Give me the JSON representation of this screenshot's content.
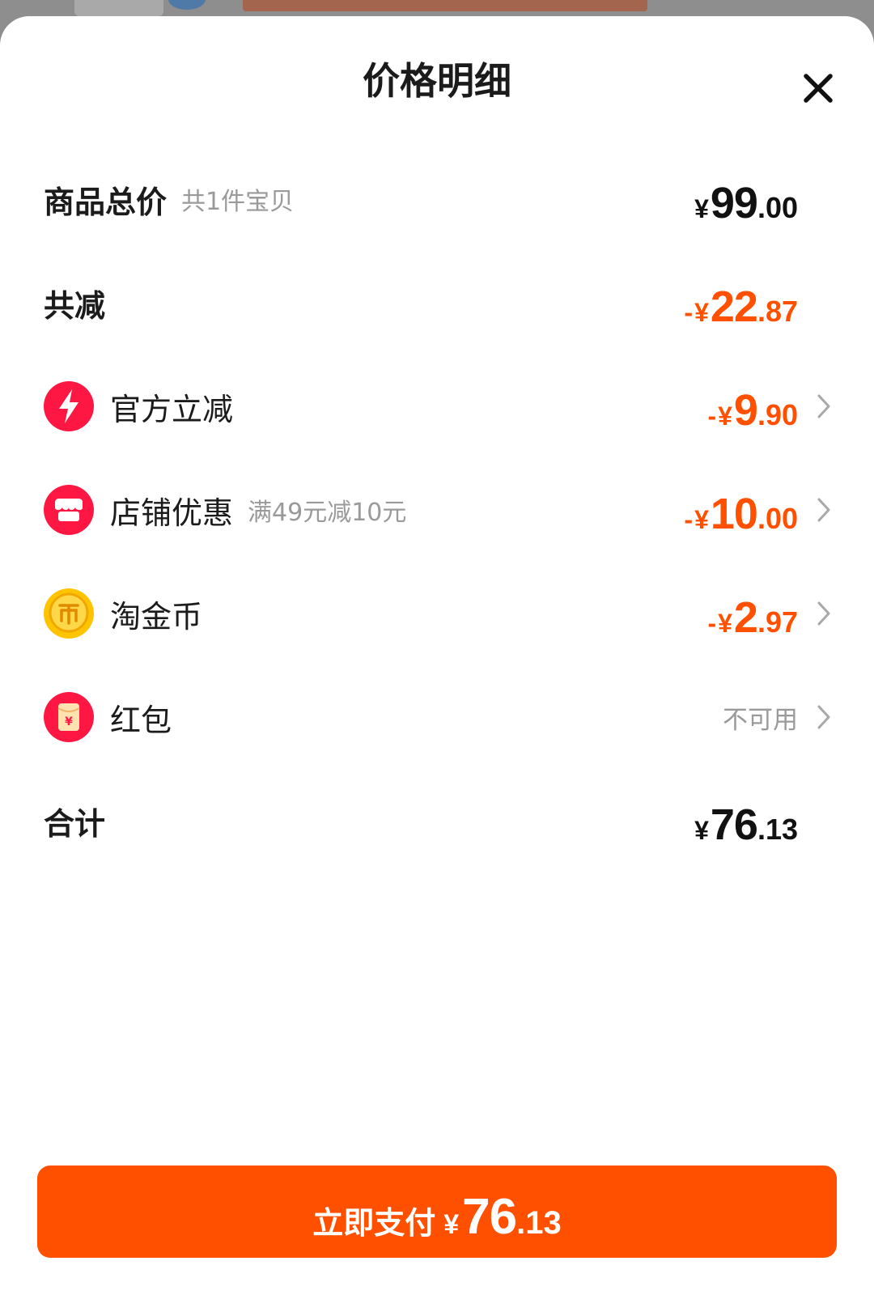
{
  "sheet": {
    "title": "价格明细"
  },
  "rows": {
    "subtotal": {
      "label": "商品总价",
      "sub": "共1件宝贝",
      "currency": "¥",
      "amount_int": "99",
      "amount_dec": ".00"
    },
    "total_discount": {
      "label": "共减",
      "sign": "-",
      "currency": "¥",
      "amount_int": "22",
      "amount_dec": ".87"
    },
    "official": {
      "label": "官方立减",
      "sign": "-",
      "currency": "¥",
      "amount_int": "9",
      "amount_dec": ".90",
      "icon": "lightning-icon"
    },
    "store": {
      "label": "店铺优惠",
      "sub": "满49元减10元",
      "sign": "-",
      "currency": "¥",
      "amount_int": "10",
      "amount_dec": ".00",
      "icon": "store-icon"
    },
    "coins": {
      "label": "淘金币",
      "sign": "-",
      "currency": "¥",
      "amount_int": "2",
      "amount_dec": ".97",
      "icon": "gold-coin-icon"
    },
    "redpacket": {
      "label": "红包",
      "status": "不可用",
      "icon": "red-envelope-icon",
      "glyph": "¥"
    },
    "total": {
      "label": "合计",
      "currency": "¥",
      "amount_int": "76",
      "amount_dec": ".13"
    }
  },
  "pay_button": {
    "label": "立即支付",
    "currency": "¥",
    "amount_int": "76",
    "amount_dec": ".13"
  },
  "colors": {
    "accent": "#ff5000",
    "official_icon": "#ff1744",
    "coin": "#ffc400",
    "text": "#1b1b1b",
    "muted": "#9a9a9a"
  }
}
